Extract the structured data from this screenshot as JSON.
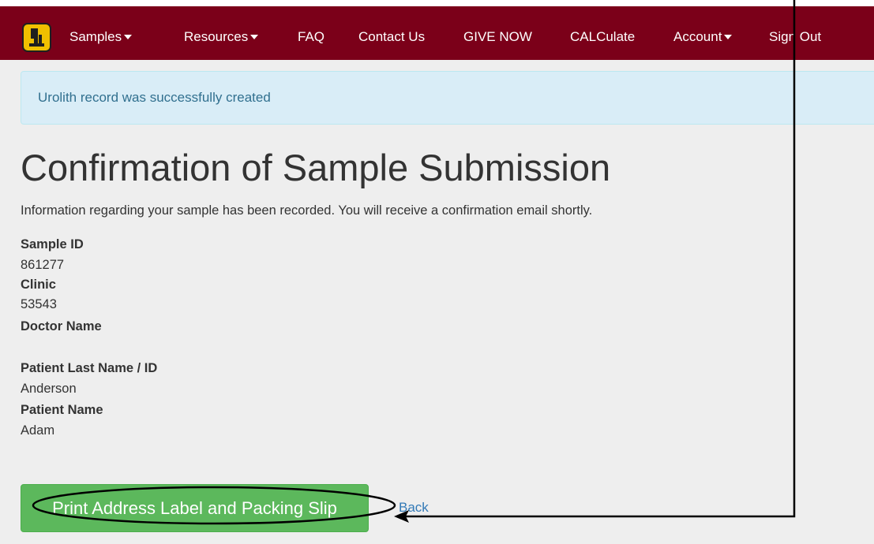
{
  "navbar": {
    "logo_icon": "microscope-logo-icon",
    "background_color": "#7b0019",
    "items": [
      {
        "label": "Samples",
        "dropdown": true
      },
      {
        "label": "Resources",
        "dropdown": true
      },
      {
        "label": "FAQ",
        "dropdown": false
      },
      {
        "label": "Contact Us",
        "dropdown": false
      },
      {
        "label": "GIVE NOW",
        "dropdown": false
      },
      {
        "label": "CALCulate",
        "dropdown": false
      },
      {
        "label": "Account",
        "dropdown": true
      },
      {
        "label": "Sign Out",
        "dropdown": false
      }
    ]
  },
  "alert": {
    "message": "Urolith record was successfully created"
  },
  "page": {
    "title": "Confirmation of Sample Submission",
    "intro": "Information regarding your sample has been recorded. You will receive a confirmation email shortly."
  },
  "details": {
    "sample_id_label": "Sample ID",
    "sample_id_value": "861277",
    "clinic_label": "Clinic",
    "clinic_value": "53543",
    "doctor_name_label": "Doctor Name",
    "doctor_name_value": "",
    "patient_last_name_label": "Patient Last Name / ID",
    "patient_last_name_value": "Anderson",
    "patient_name_label": "Patient Name",
    "patient_name_value": "Adam"
  },
  "actions": {
    "print_label": "Print Address Label and Packing Slip",
    "back_label": "Back",
    "print_color": "#5cb85c",
    "link_color": "#337ab7"
  },
  "annotation": {
    "color": "#000000",
    "shapes": [
      "ellipse-highlight",
      "arrow-pointer"
    ]
  }
}
